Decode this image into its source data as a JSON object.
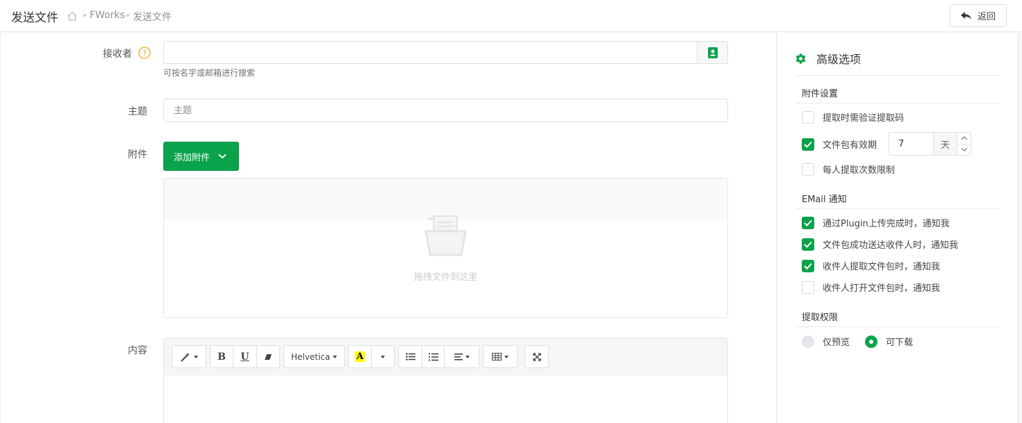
{
  "header": {
    "title": "发送文件",
    "breadcrumb": [
      "FWorks",
      "发送文件"
    ],
    "back_label": "返回"
  },
  "form": {
    "recipient_label": "接收者",
    "recipient_value": "",
    "recipient_hint": "可按名字或邮箱进行搜索",
    "subject_label": "主题",
    "subject_placeholder": "主题",
    "attachment_label": "附件",
    "add_attachment_label": "添加附件",
    "drop_text": "拖拽文件到这里",
    "content_label": "内容"
  },
  "editor_toolbar": {
    "font_name": "Helvetica"
  },
  "advanced": {
    "title": "高级选项",
    "attachment_section": "附件设置",
    "options": [
      {
        "label": "提取时需验证提取码",
        "checked": false
      },
      {
        "label": "文件包有效期",
        "checked": true
      },
      {
        "label": "每人提取次数限制",
        "checked": false
      }
    ],
    "expiry_value": "7",
    "expiry_unit": "天",
    "email_section": "EMail 通知",
    "email_options": [
      {
        "label": "通过Plugin上传完成时，通知我",
        "checked": true
      },
      {
        "label": "文件包成功送达收件人时，通知我",
        "checked": true
      },
      {
        "label": "收件人提取文件包时，通知我",
        "checked": true
      },
      {
        "label": "收件人打开文件包时，通知我",
        "checked": false
      }
    ],
    "permission_section": "提取权限",
    "permission_options": [
      {
        "label": "仅预览",
        "selected": false
      },
      {
        "label": "可下载",
        "selected": true
      }
    ]
  },
  "colors": {
    "accent": "#0aa24b",
    "help": "#f0a81f"
  }
}
